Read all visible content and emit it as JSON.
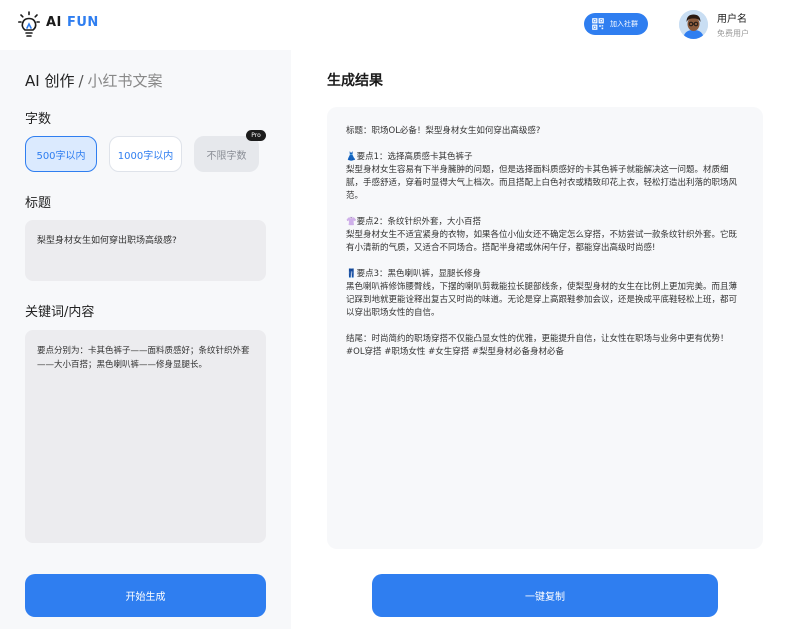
{
  "header": {
    "logo_ai": "AI",
    "logo_fun": "FUN",
    "join_label": "加入社群",
    "user_name": "用户名",
    "user_role": "免费用户"
  },
  "left": {
    "crumb_main": "AI 创作",
    "crumb_sep": "/",
    "crumb_sub": "小红书文案",
    "word_count_label": "字数",
    "word_count_options": [
      "500字以内",
      "1000字以内",
      "不限字数"
    ],
    "selected_option": "500字以内",
    "pro_badge": "Pro",
    "title_label": "标题",
    "title_value": "梨型身材女生如何穿出职场高级感?",
    "keyword_label": "关键词/内容",
    "keyword_value": "要点分别为：卡其色裤子——面料质感好；条纹针织外套——大小百搭；黑色喇叭裤——修身显腿长。",
    "generate_button": "开始生成"
  },
  "right": {
    "result_title": "生成结果",
    "paragraphs": [
      "标题：职场OL必备！梨型身材女生如何穿出高级感?",
      "👗要点1：选择高质感卡其色裤子\n梨型身材女生容易有下半身臃肿的问题，但是选择面料质感好的卡其色裤子就能解决这一问题。材质细腻，手感舒适，穿着时显得大气上档次。而且搭配上白色衬衣或精致印花上衣，轻松打造出利落的职场风范。",
      "👚要点2：条纹针织外套，大小百搭\n梨型身材女生不适宜紧身的衣物，如果各位小仙女还不确定怎么穿搭，不妨尝试一款条纹针织外套。它既有小清新的气质，又适合不同场合。搭配半身裙或休闲午仔，都能穿出高级时尚感!",
      "👖要点3：黑色喇叭裤，显腿长修身\n黑色喇叭裤修饰腰臀线，下摆的喇叭剪裁能拉长腿部线条，使梨型身材的女生在比例上更加完美。而且薄记踩到地就更能诠释出复古又时尚的味道。无论是穿上高跟鞋参加会议，还是换成平底鞋轻松上班，都可以穿出职场女性的自信。",
      "结尾：时尚简约的职场穿搭不仅能凸显女性的优雅，更能提升自信，让女性在职场与业务中更有优势！#OL穿搭 #职场女性 #女生穿搭 #梨型身材必备身材必备"
    ],
    "copy_button": "一键复制"
  },
  "colors": {
    "accent": "#2f7ef0",
    "panel": "#f7f8fa",
    "input_bg": "#ececef"
  }
}
